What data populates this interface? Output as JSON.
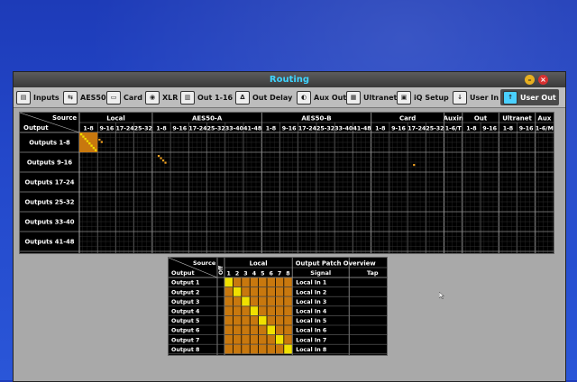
{
  "window": {
    "title": "Routing",
    "minimize": "–",
    "close": "×"
  },
  "tabs": [
    {
      "label": "Inputs",
      "icon": "inputs-icon",
      "glyph": "▤",
      "active": false
    },
    {
      "label": "AES50",
      "icon": "aes50-icon",
      "glyph": "⇆",
      "active": false
    },
    {
      "label": "Card",
      "icon": "card-icon",
      "glyph": "▭",
      "active": false
    },
    {
      "label": "XLR",
      "icon": "xlr-icon",
      "glyph": "◉",
      "active": false
    },
    {
      "label": "Out 1-16",
      "icon": "out-icon",
      "glyph": "▥",
      "active": false
    },
    {
      "label": "Out Delay",
      "icon": "delay-icon",
      "glyph": "Δ",
      "active": false
    },
    {
      "label": "Aux Out",
      "icon": "aux-out-icon",
      "glyph": "◐",
      "active": false
    },
    {
      "label": "Ultranet",
      "icon": "ultranet-icon",
      "glyph": "▦",
      "active": false
    },
    {
      "label": "iQ Setup",
      "icon": "iq-icon",
      "glyph": "▣",
      "active": false
    },
    {
      "label": "User In",
      "icon": "user-in-icon",
      "glyph": "↓",
      "active": false
    },
    {
      "label": "User Out",
      "icon": "user-out-icon",
      "glyph": "↑",
      "active": true
    }
  ],
  "matrix": {
    "corner_source": "Source",
    "corner_output": "Output",
    "groups": [
      {
        "label": "Local",
        "cols": [
          "1-8",
          "9-16",
          "17-24",
          "25-32"
        ]
      },
      {
        "label": "AES50-A",
        "cols": [
          "1-8",
          "9-16",
          "17-24",
          "25-32",
          "33-40",
          "41-48"
        ]
      },
      {
        "label": "AES50-B",
        "cols": [
          "1-8",
          "9-16",
          "17-24",
          "25-32",
          "33-40",
          "41-48"
        ]
      },
      {
        "label": "Card",
        "cols": [
          "1-8",
          "9-16",
          "17-24",
          "25-32"
        ]
      },
      {
        "label": "Auxin",
        "cols": [
          "1-6/T"
        ]
      },
      {
        "label": "Out",
        "cols": [
          "1-8",
          "9-16"
        ]
      },
      {
        "label": "Ultranet",
        "cols": [
          "1-8",
          "9-16"
        ]
      },
      {
        "label": "Aux",
        "cols": [
          "1-6/M"
        ]
      }
    ],
    "rows": [
      "Outputs 1-8",
      "Outputs 9-16",
      "Outputs 17-24",
      "Outputs 25-32",
      "Outputs 33-40",
      "Outputs 41-48"
    ],
    "selected_row": 0,
    "selected_col": 0
  },
  "overview": {
    "corner_source": "Source",
    "corner_output": "Output",
    "off_label": "Off",
    "local_label": "Local",
    "patch_label": "Output Patch Overview",
    "signal_label": "Signal",
    "tap_label": "Tap",
    "columns": [
      "1",
      "2",
      "3",
      "4",
      "5",
      "6",
      "7",
      "8"
    ],
    "rows": [
      {
        "output": "Output 1",
        "signal": "Local In 1",
        "tap": ""
      },
      {
        "output": "Output 2",
        "signal": "Local In 2",
        "tap": ""
      },
      {
        "output": "Output 3",
        "signal": "Local In 3",
        "tap": ""
      },
      {
        "output": "Output 4",
        "signal": "Local In 4",
        "tap": ""
      },
      {
        "output": "Output 5",
        "signal": "Local In 5",
        "tap": ""
      },
      {
        "output": "Output 6",
        "signal": "Local In 6",
        "tap": ""
      },
      {
        "output": "Output 7",
        "signal": "Local In 7",
        "tap": ""
      },
      {
        "output": "Output 8",
        "signal": "Local In 8",
        "tap": ""
      }
    ]
  },
  "colors": {
    "grid_bg": "#000000",
    "cell_orange": "#c8780e",
    "cell_yellow": "#f0e000",
    "title_cyan": "#3fd4ff"
  }
}
